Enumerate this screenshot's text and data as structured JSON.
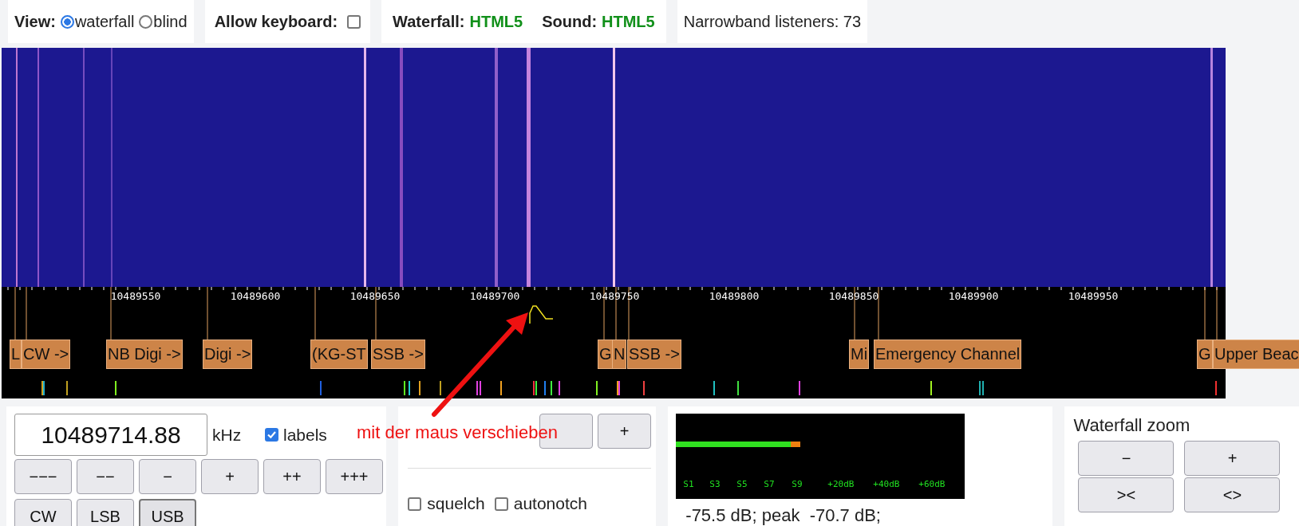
{
  "view": {
    "label": "View:",
    "options": [
      {
        "label": "waterfall",
        "selected": true
      },
      {
        "label": "blind",
        "selected": false
      }
    ]
  },
  "keyboard": {
    "label": "Allow keyboard:",
    "checked": false
  },
  "status": [
    {
      "label": "Waterfall:",
      "value": "HTML5"
    },
    {
      "label": "Sound:",
      "value": "HTML5"
    }
  ],
  "listeners": "Narrowband listeners: 73",
  "scale": {
    "ticks": [
      "10489550",
      "10489600",
      "10489650",
      "10489700",
      "10489750",
      "10489800",
      "10489850",
      "10489900",
      "10489950"
    ],
    "labels": [
      "L",
      "CW ->",
      "NB Digi ->",
      "Digi ->",
      "(KG-ST",
      "SSB ->",
      "G",
      "N",
      "SSB ->",
      "Mi",
      "Emergency Channel",
      "G",
      "Upper Beac"
    ]
  },
  "hint": "mit der maus verschieben",
  "frequency": {
    "value": "10489714.88",
    "unit": "kHz"
  },
  "labels_option": {
    "label": "labels",
    "checked": true
  },
  "step_buttons": [
    "−−−",
    "−−",
    "−",
    "+",
    "++",
    "+++"
  ],
  "modes": [
    {
      "label": "CW",
      "selected": false
    },
    {
      "label": "LSB",
      "selected": false
    },
    {
      "label": "USB",
      "selected": true
    }
  ],
  "filter": {
    "wider_button": "+"
  },
  "options": [
    {
      "label": "squelch",
      "checked": false
    },
    {
      "label": "autonotch",
      "checked": false
    }
  ],
  "smeter": {
    "scale": [
      "S1",
      "S3",
      "S5",
      "S7",
      "S9",
      "+20dB",
      "+40dB",
      "+60dB"
    ],
    "reading": "-75.5 dB; peak  -70.7 dB;"
  },
  "zoom": {
    "title": "Waterfall zoom",
    "buttons": [
      "−",
      "+",
      "><",
      "<>"
    ]
  }
}
